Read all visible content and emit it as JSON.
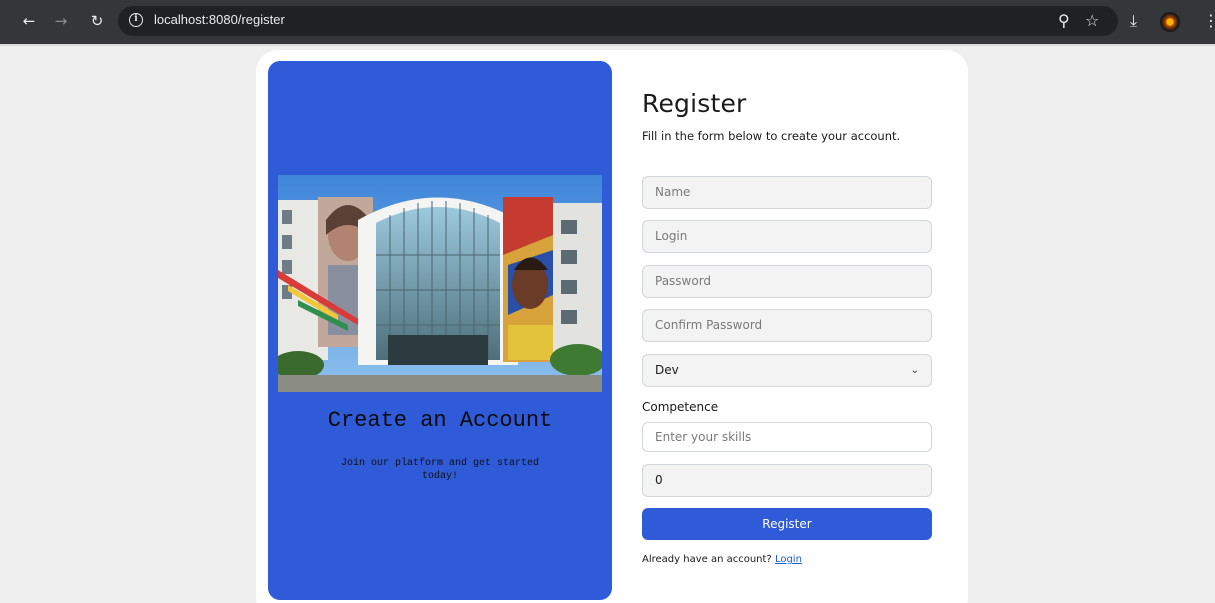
{
  "browser": {
    "url": "localhost:8080/register",
    "icons": [
      "back-arrow-icon",
      "forward-arrow-icon",
      "reload-icon",
      "info-icon",
      "zoom-icon",
      "star-icon",
      "download-icon",
      "menu-icon"
    ]
  },
  "panel": {
    "title": "Create an Account",
    "subtitle": "Join our platform and get started today!",
    "background": "#2f5ad8"
  },
  "form": {
    "title": "Register",
    "subtitle": "Fill in the form below to create your account.",
    "name_placeholder": "Name",
    "login_placeholder": "Login",
    "password_placeholder": "Password",
    "confirm_placeholder": "Confirm Password",
    "role_selected": "Dev",
    "competence_label": "Competence",
    "skills_placeholder": "Enter your skills",
    "number_value": "0",
    "submit_label": "Register",
    "login_prompt": "Already have an account?",
    "login_link": "Login",
    "accent": "#2f5ad8"
  }
}
